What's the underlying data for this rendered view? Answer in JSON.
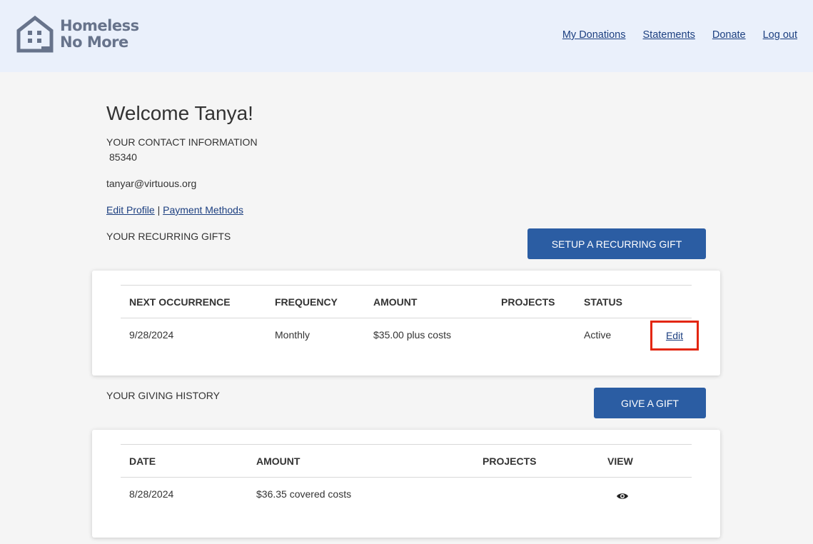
{
  "header": {
    "logo_line1": "Homeless",
    "logo_line2": "No More",
    "nav": [
      "My Donations",
      "Statements",
      "Donate",
      "Log out"
    ]
  },
  "profile": {
    "welcome": "Welcome Tanya!",
    "contact_label": "YOUR CONTACT INFORMATION",
    "zip": "85340",
    "email": "tanyar@virtuous.org",
    "edit_profile": "Edit Profile",
    "separator": "|",
    "payment_methods": "Payment Methods"
  },
  "recurring": {
    "label": "YOUR RECURRING GIFTS",
    "button": "SETUP A RECURRING GIFT",
    "columns": [
      "NEXT OCCURRENCE",
      "FREQUENCY",
      "AMOUNT",
      "PROJECTS",
      "STATUS"
    ],
    "rows": [
      {
        "next": "9/28/2024",
        "frequency": "Monthly",
        "amount": "$35.00 plus costs",
        "projects": "",
        "status": "Active",
        "action": "Edit"
      }
    ]
  },
  "history": {
    "label": "YOUR GIVING HISTORY",
    "button": "GIVE A GIFT",
    "columns": [
      "DATE",
      "AMOUNT",
      "PROJECTS",
      "VIEW"
    ],
    "rows": [
      {
        "date": "8/28/2024",
        "amount": "$36.35 covered costs",
        "projects": "",
        "view_icon": "eye-icon"
      }
    ]
  },
  "colors": {
    "header_bg": "#eaf0fb",
    "accent": "#2b5da3",
    "link": "#1c3f80",
    "highlight": "#e3260f",
    "logo": "#67738b"
  }
}
